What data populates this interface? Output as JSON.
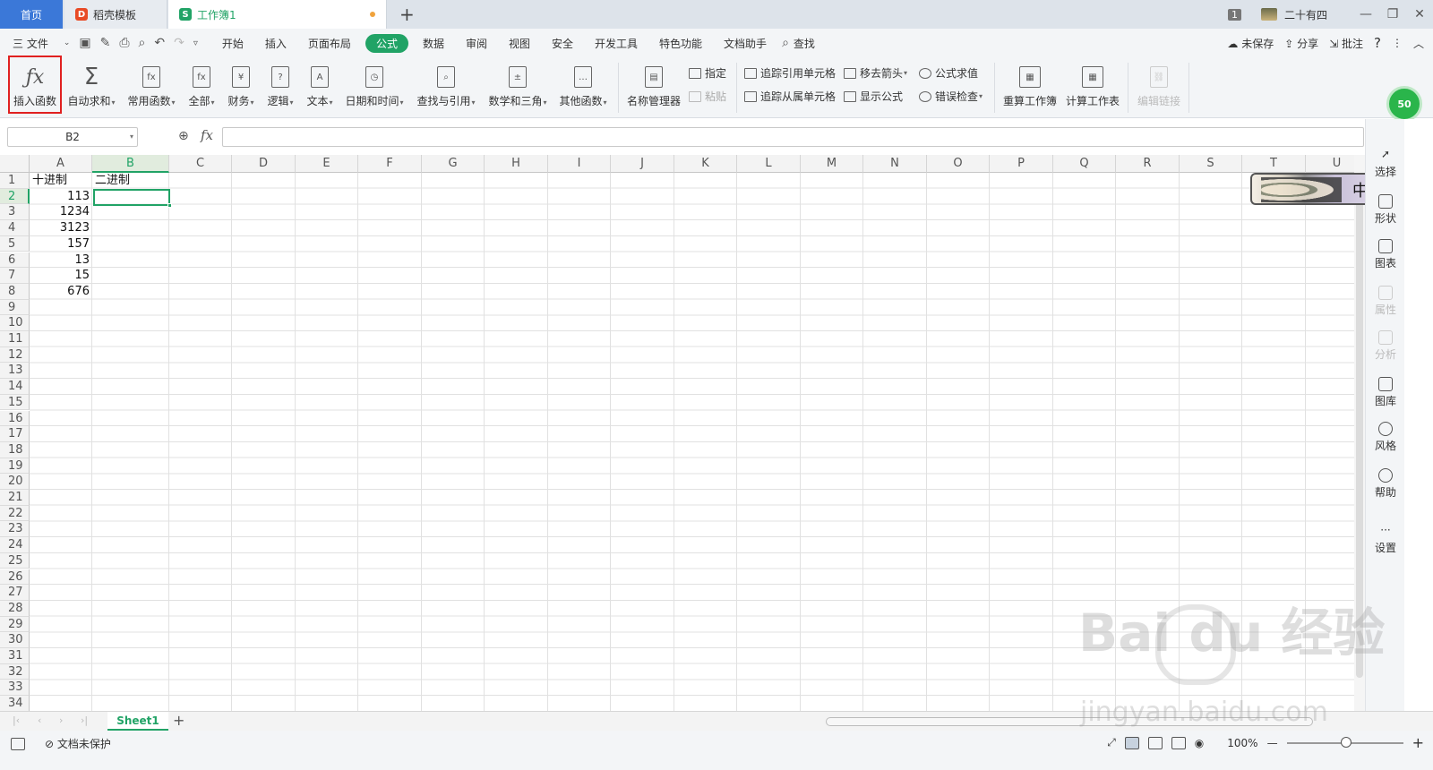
{
  "tabs": {
    "home": "首页",
    "daoke": "稻壳模板",
    "workbook": "工作簿1",
    "add": "+"
  },
  "titlebar_right": {
    "badge": "1",
    "user": "二十有四",
    "minimize": "—",
    "restore": "❐",
    "close": "✕"
  },
  "menubar": {
    "file": "三 文件",
    "items": [
      "开始",
      "插入",
      "页面布局",
      "公式",
      "数据",
      "审阅",
      "视图",
      "安全",
      "开发工具",
      "特色功能",
      "文档助手",
      "查找"
    ],
    "active_index": 3,
    "right": {
      "unsaved": "未保存",
      "share": "分享",
      "annotate": "批注",
      "help": "?",
      "more": "⋮",
      "collapse": "︿"
    }
  },
  "ribbon": {
    "insert_function": "插入函数",
    "autosum": "自动求和",
    "common": "常用函数",
    "all": "全部",
    "finance": "财务",
    "logic": "逻辑",
    "text": "文本",
    "datetime": "日期和时间",
    "lookup": "查找与引用",
    "math": "数学和三角",
    "other": "其他函数",
    "name_manager": "名称管理器",
    "specify": "指定",
    "paste": "粘贴",
    "trace_precedents": "追踪引用单元格",
    "trace_dependents": "追踪从属单元格",
    "remove_arrows": "移去箭头",
    "show_formulas": "显示公式",
    "evaluate": "公式求值",
    "error_check": "错误检查",
    "recalc_book": "重算工作簿",
    "calc_sheet": "计算工作表",
    "edit_links": "编辑链接",
    "green_badge": "50"
  },
  "formula_bar": {
    "name_box": "B2",
    "fx": "fx",
    "formula": ""
  },
  "columns": [
    "A",
    "B",
    "C",
    "D",
    "E",
    "F",
    "G",
    "H",
    "I",
    "J",
    "K",
    "L",
    "M",
    "N",
    "O",
    "P",
    "Q",
    "R",
    "S",
    "T",
    "U"
  ],
  "selected_column": "B",
  "rows": [
    "1",
    "2",
    "3",
    "4",
    "5",
    "6",
    "7",
    "8",
    "9",
    "10",
    "11",
    "12",
    "13",
    "14",
    "15",
    "16",
    "17",
    "18",
    "19",
    "20",
    "21",
    "22",
    "23",
    "24",
    "25",
    "26",
    "27",
    "28",
    "29",
    "30",
    "31",
    "32",
    "33",
    "34"
  ],
  "selected_row": "2",
  "cells": {
    "A1": "十进制",
    "B1": "二进制",
    "A2": "113",
    "A3": "1234",
    "A4": "3123",
    "A5": "157",
    "A6": "13",
    "A7": "15",
    "A8": "676"
  },
  "floating_image": {
    "label": "中"
  },
  "right_panel": [
    "选择",
    "形状",
    "图表",
    "属性",
    "分析",
    "图库",
    "风格",
    "帮助",
    "设置"
  ],
  "sheets": [
    "Sheet1"
  ],
  "add_sheet": "+",
  "status": {
    "protect": "文档未保护",
    "zoom": "100%",
    "minus": "—",
    "plus": "+"
  },
  "watermark": {
    "main": "Bai du 经验",
    "url": "jingyan.baidu.com"
  }
}
